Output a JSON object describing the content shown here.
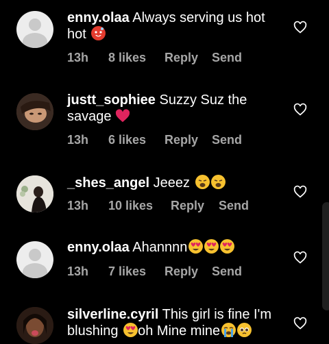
{
  "comments": [
    {
      "username": "enny.olaa",
      "text": "Always serving us hot hot",
      "emojis": [
        "hot-face"
      ],
      "time": "13h",
      "likes": "8 likes",
      "reply": "Reply",
      "send": "Send"
    },
    {
      "username": "justt_sophiee",
      "text": "Suzzy Suz the savage",
      "emojis": [
        "red-heart"
      ],
      "time": "13h",
      "likes": "6 likes",
      "reply": "Reply",
      "send": "Send"
    },
    {
      "username": "_shes_angel",
      "text": "Jeeez",
      "emojis": [
        "weary-face",
        "weary-face"
      ],
      "time": "13h",
      "likes": "10 likes",
      "reply": "Reply",
      "send": "Send"
    },
    {
      "username": "enny.olaa",
      "text": "Ahannnn",
      "emojis": [
        "heart-eyes",
        "heart-eyes",
        "heart-eyes"
      ],
      "time": "13h",
      "likes": "7 likes",
      "reply": "Reply",
      "send": "Send"
    },
    {
      "username": "silverline.cyril",
      "text": "This girl is fine I'm blushing",
      "text_after": "oh Mine mine",
      "emojis": [
        "heart-eyes",
        "loudly-crying",
        "pleading-face"
      ],
      "time": "",
      "likes": "",
      "reply": "",
      "send": ""
    }
  ],
  "colors": {
    "background": "#000000",
    "text": "#ffffff",
    "meta": "#a6a6a6",
    "heart_like": "#e0245e"
  }
}
